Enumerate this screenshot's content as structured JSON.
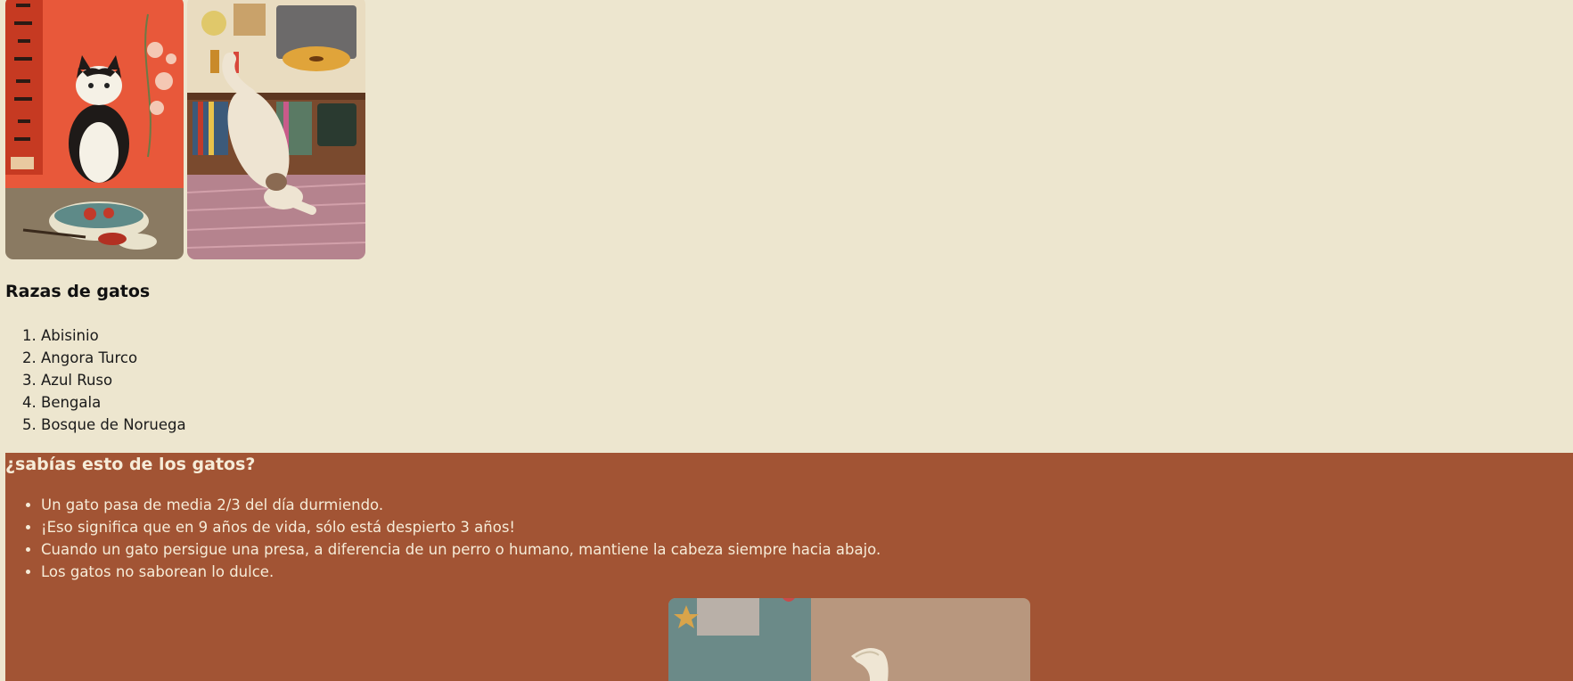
{
  "gallery": {
    "images": [
      {
        "icon": "cat-with-noodle-bowl-illustration"
      },
      {
        "icon": "cat-stretching-by-record-player-illustration"
      }
    ]
  },
  "breeds": {
    "title": "Razas de gatos",
    "items": [
      "Abisinio",
      "Angora Turco",
      "Azul Ruso",
      "Bengala",
      "Bosque de Noruega"
    ]
  },
  "facts": {
    "title": "¿sabías esto de los gatos?",
    "items": [
      "Un gato pasa de media 2/3 del día durmiendo.",
      "¡Eso significa que en 9 años de vida, sólo está despierto 3 años!",
      "Cuando un gato persigue una presa, a diferencia de un perro o humano, mantiene la cabeza siempre hacia abajo.",
      "Los gatos no saborean lo dulce."
    ],
    "image": {
      "icon": "cat-tail-illustration"
    }
  },
  "colors": {
    "background": "#ede6cf",
    "facts_background": "#a25434",
    "facts_text": "#f6ecd8"
  }
}
